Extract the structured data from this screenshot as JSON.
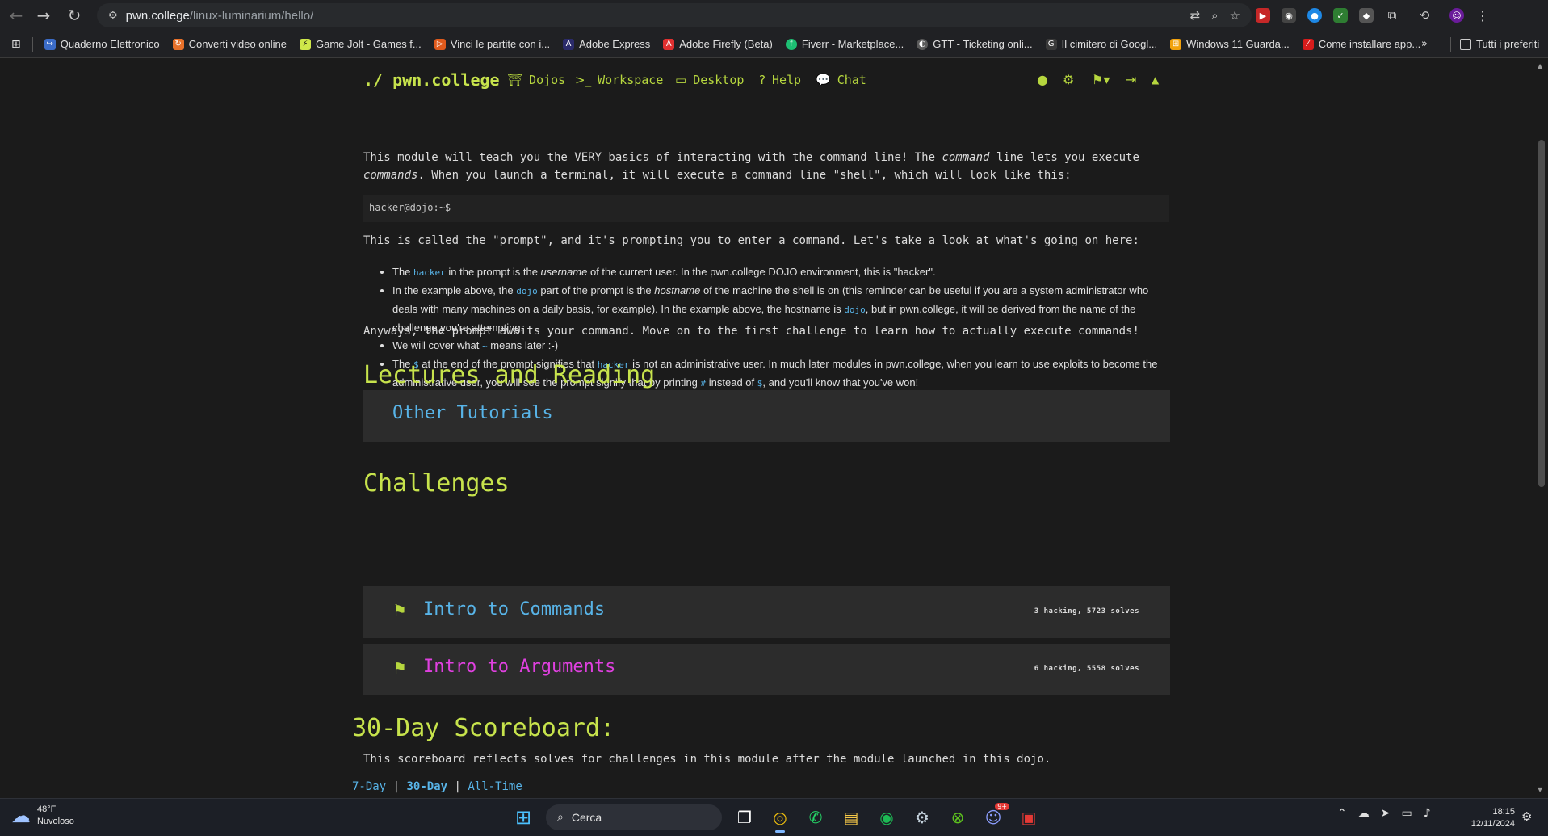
{
  "browser": {
    "url_host": "pwn.college",
    "url_path": "/linux-luminarium/hello/",
    "icons": [
      "back-icon",
      "forward-icon",
      "reload-icon",
      "site-settings-icon",
      "translate-icon",
      "zoom-icon",
      "bookmark-star-icon",
      "extensions-icon",
      "profile-icon",
      "menu-icon"
    ]
  },
  "bookmarks": {
    "items": [
      {
        "label": "Quaderno Elettronico",
        "color": "#3b6cc8"
      },
      {
        "label": "Converti video online",
        "color": "#e8712a"
      },
      {
        "label": "Game Jolt - Games f...",
        "color": "#cfe84a"
      },
      {
        "label": "Vinci le partite con i...",
        "color": "#e05a1c"
      },
      {
        "label": "Adobe Express",
        "color": "#2b2b6b"
      },
      {
        "label": "Adobe Firefly (Beta)",
        "color": "#e03030"
      },
      {
        "label": "Fiverr - Marketplace...",
        "color": "#1dbf73"
      },
      {
        "label": "GTT - Ticketing onli...",
        "color": "#5a5a5a"
      },
      {
        "label": "Il cimitero di Googl...",
        "color": "#3a3a3a"
      },
      {
        "label": "Windows 11 Guarda...",
        "color": "#f2a20c"
      },
      {
        "label": "Come installare app...",
        "color": "#d81c1c"
      }
    ],
    "all_bookmarks": "Tutti i preferiti"
  },
  "site_nav": {
    "brand": "./ pwn.college",
    "links": [
      {
        "label": "Dojos",
        "icon": "dojo-torii-icon"
      },
      {
        "label": "Workspace",
        "icon": "terminal-icon"
      },
      {
        "label": "Desktop",
        "icon": "desktop-icon"
      },
      {
        "label": "Help",
        "icon": "question-icon"
      },
      {
        "label": "Chat",
        "icon": "chat-icon"
      }
    ]
  },
  "content": {
    "intro_1": "This module will teach you the VERY basics of interacting with the command line! The ",
    "intro_em1": "command",
    "intro_2": " line lets you execute ",
    "intro_em2": "commands",
    "intro_3": ". When you launch a terminal, it will execute a command line \"shell\", which will look like this:",
    "prompt_example": "hacker@dojo:~$",
    "prompt_para": "This is called the \"prompt\", and it's prompting you to enter a command. Let's take a look at what's going on here:",
    "list": {
      "li1_a": "The ",
      "li1_code": "hacker",
      "li1_b": " in the prompt is the ",
      "li1_em": "username",
      "li1_c": " of the current user. In the pwn.college DOJO environment, this is \"hacker\".",
      "li2_a": "In the example above, the ",
      "li2_code": "dojo",
      "li2_b": " part of the prompt is the ",
      "li2_em": "hostname",
      "li2_c": " of the machine the shell is on (this reminder can be useful if you are a system administrator who deals with many machines on a daily basis, for example). In the example above, the hostname is ",
      "li2_code2": "dojo",
      "li2_d": ", but in pwn.college, it will be derived from the name of the challenge you're attempting.",
      "li3_a": "We will cover what ",
      "li3_code": "~",
      "li3_b": " means later :-)",
      "li4_a": "The ",
      "li4_code": "$",
      "li4_b": " at the end of the prompt signifies that ",
      "li4_code2": "hacker",
      "li4_c": " is not an administrative user. In much later modules in pwn.college, when you learn to use exploits to become the administrative user, you will see the prompt signify that by printing ",
      "li4_code3": "#",
      "li4_d": " instead of ",
      "li4_code4": "$",
      "li4_e": ", and you'll know that you've won!"
    },
    "closing": "Anyways, the prompt awaits your command. Move on to the first challenge to learn how to actually execute commands!"
  },
  "lectures": {
    "heading": "Lectures and Reading",
    "items": [
      {
        "label": "Other Tutorials"
      }
    ]
  },
  "challenges": {
    "heading": "Challenges",
    "items": [
      {
        "label": "Intro to Commands",
        "stats": "3 hacking, 5723 solves",
        "color": "#58b4e8"
      },
      {
        "label": "Intro to Arguments",
        "stats": "6 hacking, 5558 solves",
        "color": "#e040e0"
      }
    ]
  },
  "scoreboard": {
    "heading": "30-Day Scoreboard:",
    "description": "This scoreboard reflects solves for challenges in this module after the module launched in this dojo.",
    "tabs": [
      "7-Day",
      "30-Day",
      "All-Time"
    ],
    "separator": "|",
    "active_tab": "30-Day"
  },
  "taskbar": {
    "weather_temp": "48°F",
    "weather_desc": "Nuvoloso",
    "search_placeholder": "Cerca",
    "time": "18:15",
    "date": "12/11/2024",
    "discord_badge": "9+"
  },
  "colors": {
    "accent_green": "#c7e34c",
    "link_blue": "#58b4e8",
    "magenta": "#e040e0",
    "background": "#1b1b1b",
    "card": "#2c2c2c"
  }
}
